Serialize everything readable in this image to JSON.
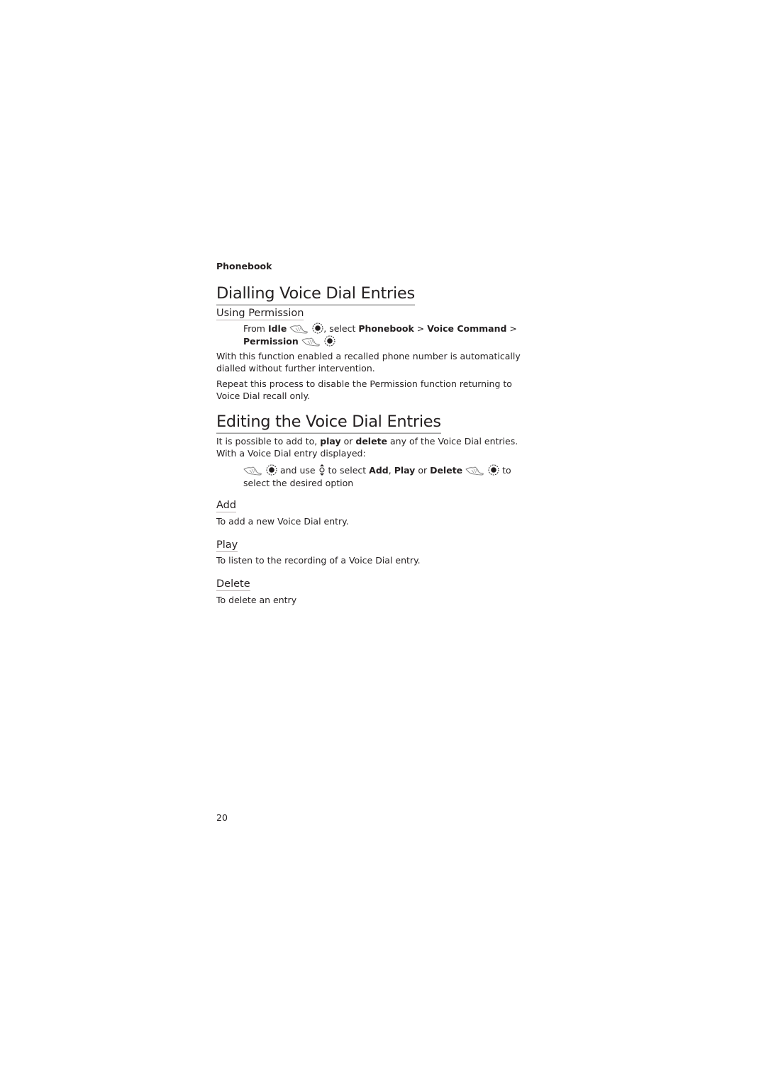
{
  "header": {
    "section": "Phonebook"
  },
  "section1": {
    "title": "Dialling Voice Dial Entries",
    "subtitle": "Using Permission",
    "step": {
      "from": "From ",
      "idle": "Idle",
      "select": ", select ",
      "phonebook": "Phonebook",
      "sep1": " > ",
      "voice_command": "Voice Command",
      "sep2": " >",
      "permission": "Permission"
    },
    "para1": "With this function enabled a recalled phone number is automatically dialled without further intervention.",
    "para2": "Repeat this process to disable the Permission function returning to Voice Dial recall only."
  },
  "section2": {
    "title": "Editing the Voice Dial Entries",
    "intro_a": "It is possible to add to, ",
    "intro_play": "play",
    "intro_b": " or ",
    "intro_delete": "delete",
    "intro_c": " any of the Voice Dial entries. With a Voice Dial entry displayed:",
    "step": {
      "and_use": " and use ",
      "to_select": " to select ",
      "add": "Add",
      "comma": ", ",
      "play": "Play",
      "or": " or ",
      "delete": "Delete",
      "to": " to",
      "tail": "select the desired option"
    },
    "options": [
      {
        "title": "Add",
        "desc": "To add a new Voice Dial entry."
      },
      {
        "title": "Play",
        "desc": "To listen to the recording of a Voice Dial entry."
      },
      {
        "title": "Delete",
        "desc": "To delete an entry"
      }
    ]
  },
  "icons": {
    "menu_key": "menu-key-icon",
    "ok_button": "ok-button-icon",
    "nav_updown": "nav-up-down-icon"
  },
  "footer": {
    "page_number": "20"
  }
}
